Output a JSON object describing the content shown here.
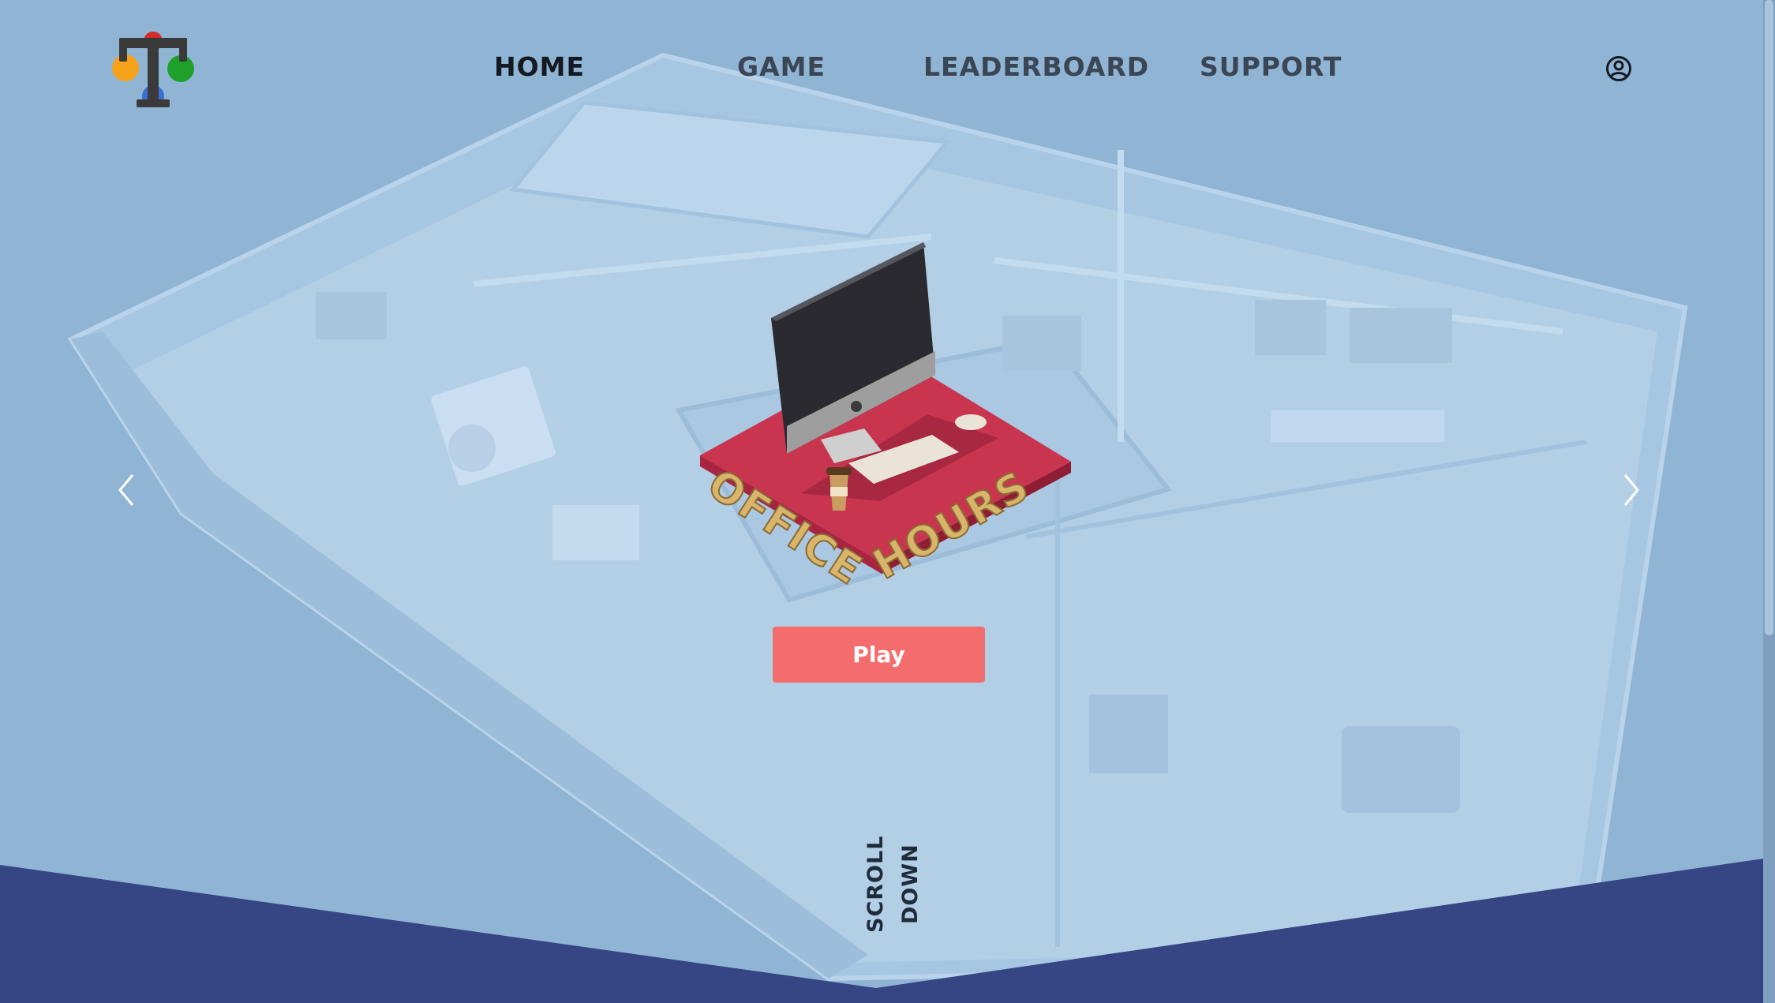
{
  "nav": {
    "items": [
      {
        "label": "HOME",
        "active": true
      },
      {
        "label": "GAME",
        "active": false
      },
      {
        "label": "LEADERBOARD",
        "active": false
      },
      {
        "label": "SUPPORT",
        "active": false
      }
    ]
  },
  "hero": {
    "logo_text_line1": "OFFICE",
    "logo_text_line2": "HOURS",
    "play_label": "Play",
    "scroll_label": "SCROLL DOWN"
  },
  "icons": {
    "account": "user-circle-icon",
    "prev": "chevron-left-icon",
    "next": "chevron-right-icon"
  },
  "colors": {
    "background": "#90b4d4",
    "footer_band": "#364584",
    "play_button": "#f46d6d",
    "nav_active": "#151a22",
    "nav_inactive": "#3b4654"
  }
}
